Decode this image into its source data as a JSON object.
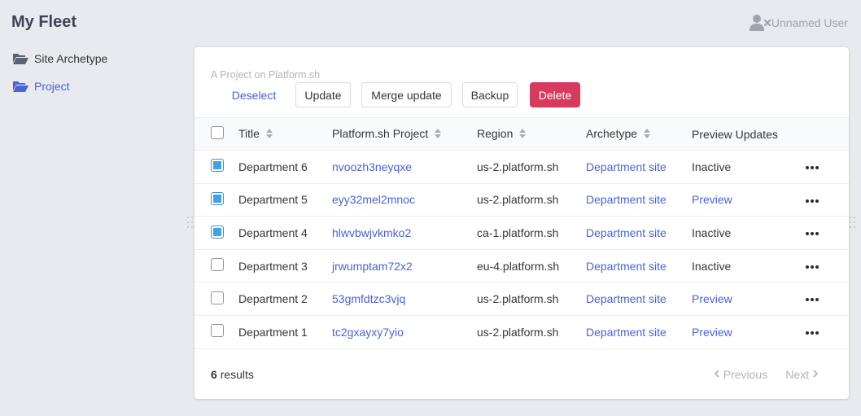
{
  "header": {
    "title": "My Fleet",
    "user_name": "Unnamed User",
    "user_icon": "user-x-icon"
  },
  "sidebar": {
    "items": [
      {
        "label": "Site Archetype",
        "icon": "folder-open-icon",
        "active": false
      },
      {
        "label": "Project",
        "icon": "folder-open-icon",
        "active": true
      }
    ]
  },
  "panel": {
    "subtitle": "A Project on Platform.sh",
    "toolbar": {
      "deselect": "Deselect",
      "update": "Update",
      "merge_update": "Merge update",
      "backup": "Backup",
      "delete": "Delete"
    },
    "table": {
      "columns": [
        "Title",
        "Platform.sh Project",
        "Region",
        "Archetype",
        "Preview Updates"
      ],
      "rows": [
        {
          "checked": true,
          "title": "Department 6",
          "project": "nvoozh3neyqxe",
          "region": "us-2.platform.sh",
          "archetype": "Department site",
          "preview": "Inactive"
        },
        {
          "checked": true,
          "title": "Department 5",
          "project": "eyy32mel2mnoc",
          "region": "us-2.platform.sh",
          "archetype": "Department site",
          "preview": "Preview"
        },
        {
          "checked": true,
          "title": "Department 4",
          "project": "hlwvbwjvkmko2",
          "region": "ca-1.platform.sh",
          "archetype": "Department site",
          "preview": "Inactive"
        },
        {
          "checked": false,
          "title": "Department 3",
          "project": "jrwumptam72x2",
          "region": "eu-4.platform.sh",
          "archetype": "Department site",
          "preview": "Inactive"
        },
        {
          "checked": false,
          "title": "Department 2",
          "project": "53gmfdtzc3vjq",
          "region": "us-2.platform.sh",
          "archetype": "Department site",
          "preview": "Preview"
        },
        {
          "checked": false,
          "title": "Department 1",
          "project": "tc2gxayxy7yio",
          "region": "us-2.platform.sh",
          "archetype": "Department site",
          "preview": "Preview"
        }
      ]
    },
    "footer": {
      "count": "6",
      "results_label": "results",
      "previous": "Previous",
      "next": "Next"
    }
  },
  "colors": {
    "accent": "#4a63d6",
    "danger": "#d63a5d",
    "checkbox_checked": "#3fa3ea",
    "background": "#e8eaf0"
  }
}
